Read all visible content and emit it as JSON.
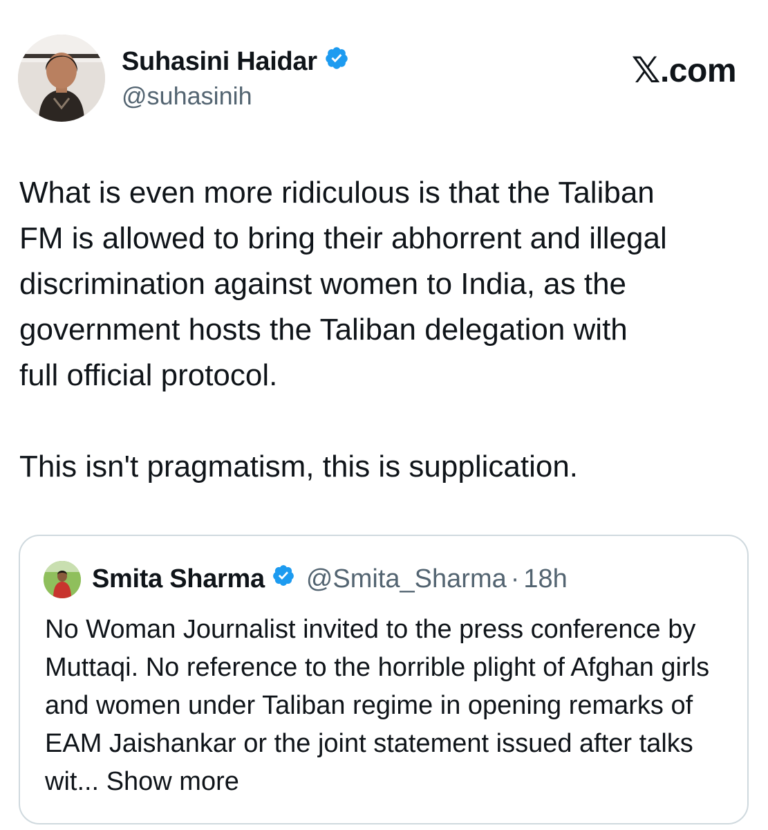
{
  "tweet": {
    "author_name": "Suhasini Haidar",
    "author_handle": "@suhasinih",
    "body": "What is even more ridiculous is that the Taliban\nFM is allowed to bring their abhorrent and illegal\ndiscrimination against women to India, as the\ngovernment hosts the Taliban delegation with\nfull official protocol.\n\nThis isn't pragmatism, this is supplication."
  },
  "brand": {
    "x_glyph": "𝕏",
    "suffix": ".com"
  },
  "quoted_tweet": {
    "author_name": "Smita Sharma",
    "author_handle": "@Smita_Sharma",
    "separator": "·",
    "time": "18h",
    "body": "No Woman Journalist invited to the press conference by Muttaqi. No reference to the horrible plight of Afghan girls and women under Taliban regime in opening remarks of EAM Jaishankar or the joint statement issued after talks wit...",
    "show_more": "Show more"
  },
  "colors": {
    "verified_blue": "#1d9bf0",
    "secondary_text": "#536471",
    "border": "#cfd9de"
  },
  "icons": [
    "verified-badge-icon",
    "x-logo-icon"
  ]
}
